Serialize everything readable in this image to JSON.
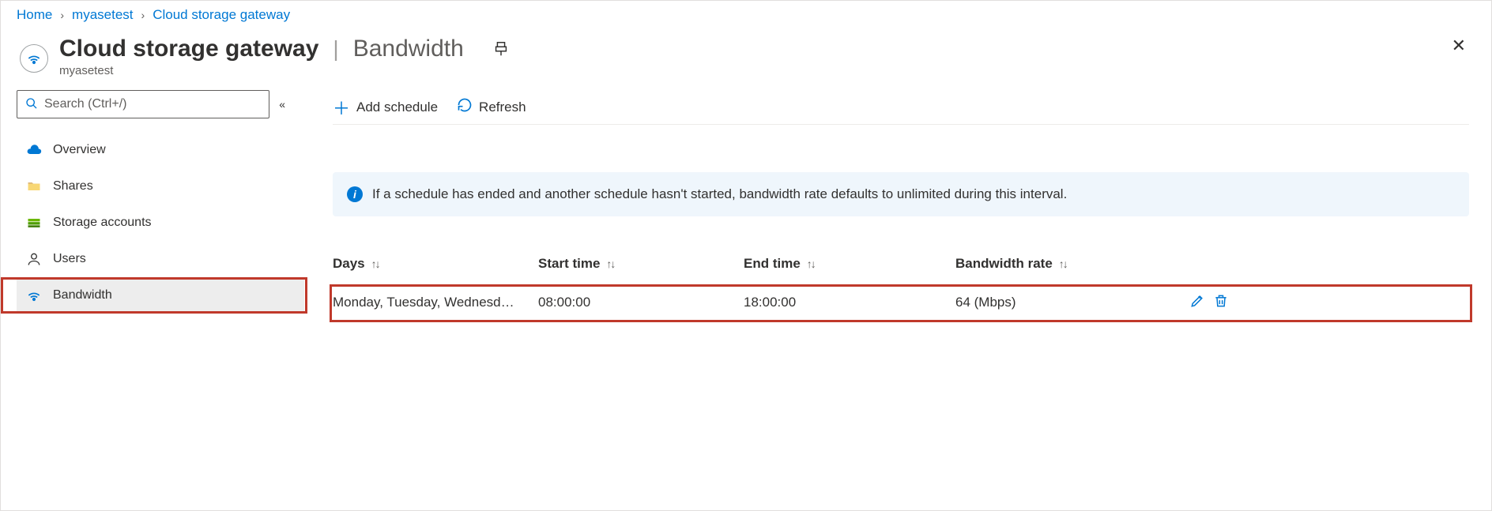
{
  "breadcrumb": {
    "home": "Home",
    "resource": "myasetest",
    "service": "Cloud storage gateway"
  },
  "header": {
    "title": "Cloud storage gateway",
    "section": "Bandwidth",
    "resource_name": "myasetest"
  },
  "search": {
    "placeholder": "Search (Ctrl+/)"
  },
  "sidebar": {
    "items": [
      {
        "label": "Overview"
      },
      {
        "label": "Shares"
      },
      {
        "label": "Storage accounts"
      },
      {
        "label": "Users"
      },
      {
        "label": "Bandwidth"
      }
    ]
  },
  "toolbar": {
    "add_schedule_label": "Add schedule",
    "refresh_label": "Refresh"
  },
  "banner": {
    "text": "If a schedule has ended and another schedule hasn't started, bandwidth rate defaults to unlimited during this interval."
  },
  "table": {
    "columns": {
      "days": "Days",
      "start": "Start time",
      "end": "End time",
      "rate": "Bandwidth rate"
    },
    "rows": [
      {
        "days": "Monday, Tuesday, Wednesd…",
        "start": "08:00:00",
        "end": "18:00:00",
        "rate": "64 (Mbps)"
      }
    ]
  }
}
